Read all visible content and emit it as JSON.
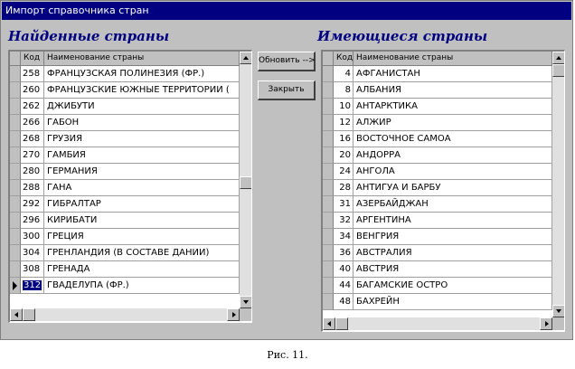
{
  "window": {
    "title": "Импорт справочника стран"
  },
  "found": {
    "heading": "Найденные страны",
    "columns": {
      "code": "Код",
      "name": "Наименование страны"
    },
    "rows": [
      {
        "code": "258",
        "name": "ФРАНЦУЗСКАЯ ПОЛИНЕЗИЯ (ФР.)"
      },
      {
        "code": "260",
        "name": "ФРАНЦУЗСКИЕ ЮЖНЫЕ ТЕРРИТОРИИ ("
      },
      {
        "code": "262",
        "name": "ДЖИБУТИ"
      },
      {
        "code": "266",
        "name": "ГАБОН"
      },
      {
        "code": "268",
        "name": "ГРУЗИЯ"
      },
      {
        "code": "270",
        "name": "ГАМБИЯ"
      },
      {
        "code": "280",
        "name": "ГЕРМАНИЯ"
      },
      {
        "code": "288",
        "name": "ГАНА"
      },
      {
        "code": "292",
        "name": "ГИБРАЛТАР"
      },
      {
        "code": "296",
        "name": "КИРИБАТИ"
      },
      {
        "code": "300",
        "name": "ГРЕЦИЯ"
      },
      {
        "code": "304",
        "name": "ГРЕНЛАНДИЯ (В СОСТАВЕ ДАНИИ)"
      },
      {
        "code": "308",
        "name": "ГРЕНАДА"
      },
      {
        "code": "312",
        "name": "ГВАДЕЛУПА (ФР.)"
      }
    ],
    "current_row": 13
  },
  "existing": {
    "heading": "Имеющиеся страны",
    "columns": {
      "code": "Код",
      "name": "Наименование страны"
    },
    "rows": [
      {
        "code": "4",
        "name": "АФГАНИСТАН"
      },
      {
        "code": "8",
        "name": "АЛБАНИЯ"
      },
      {
        "code": "10",
        "name": "АНТАРКТИКА"
      },
      {
        "code": "12",
        "name": "АЛЖИР"
      },
      {
        "code": "16",
        "name": "ВОСТОЧНОЕ САМОА"
      },
      {
        "code": "20",
        "name": "АНДОРРА"
      },
      {
        "code": "24",
        "name": "АНГОЛА"
      },
      {
        "code": "28",
        "name": "АНТИГУА И БАРБУ"
      },
      {
        "code": "31",
        "name": "АЗЕРБАЙДЖАН"
      },
      {
        "code": "32",
        "name": "АРГЕНТИНА"
      },
      {
        "code": "34",
        "name": "ВЕНГРИЯ"
      },
      {
        "code": "36",
        "name": "АВСТРАЛИЯ"
      },
      {
        "code": "40",
        "name": "АВСТРИЯ"
      },
      {
        "code": "44",
        "name": "БАГАМСКИЕ ОСТРО"
      },
      {
        "code": "48",
        "name": "БАХРЕЙН"
      }
    ]
  },
  "buttons": {
    "refresh": "Обновить -->",
    "close": "Закрыть"
  },
  "caption": "Рис. 11."
}
